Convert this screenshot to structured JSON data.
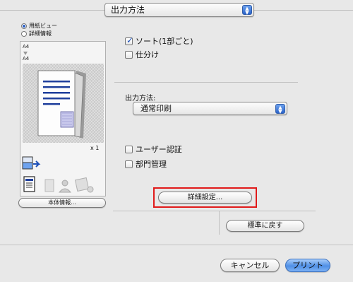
{
  "header": {
    "output_method_popup": "出力方法"
  },
  "preview": {
    "view_options": [
      {
        "label": "用紙ビュー",
        "selected": true
      },
      {
        "label": "詳細情報",
        "selected": false
      }
    ],
    "paper_from": "A4",
    "paper_to": "A4",
    "copies": "x 1",
    "machine_info_button": "本体情報..."
  },
  "output": {
    "sort_label": "ソート(1部ごと)",
    "sort_checked": true,
    "offset_label": "仕分け",
    "offset_checked": false,
    "method_label": "出力方法:",
    "method_value": "通常印刷",
    "user_auth_label": "ユーザー認証",
    "user_auth_checked": false,
    "account_track_label": "部門管理",
    "account_track_checked": false,
    "details_button": "詳細設定...",
    "restore_defaults_button": "標準に戻す"
  },
  "footer": {
    "cancel_button": "キャンセル",
    "print_button": "プリント"
  },
  "colors": {
    "accent": "#2b63c9",
    "highlight": "#e11a1a"
  }
}
